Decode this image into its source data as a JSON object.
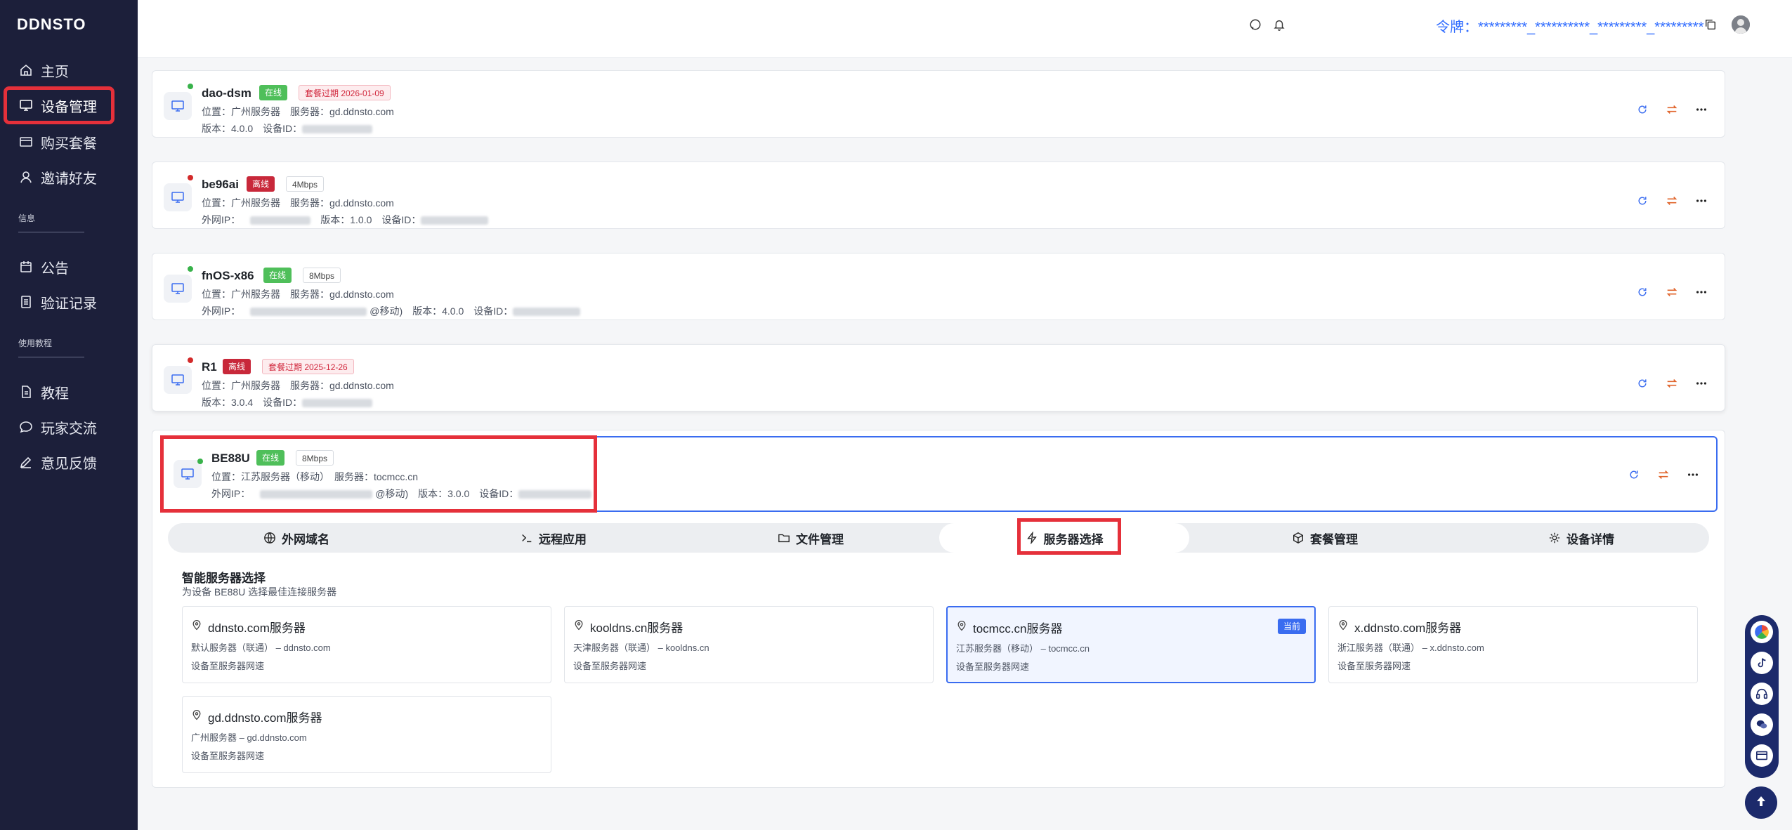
{
  "app": {
    "logo": "DDNSTO"
  },
  "sidebar": {
    "items": [
      {
        "label": "主页",
        "icon": "home-icon"
      },
      {
        "label": "设备管理",
        "icon": "monitor-icon"
      },
      {
        "label": "购买套餐",
        "icon": "card-icon"
      },
      {
        "label": "邀请好友",
        "icon": "user-icon"
      },
      {
        "label": "公告",
        "icon": "calendar-icon"
      },
      {
        "label": "验证记录",
        "icon": "list-icon"
      },
      {
        "label": "教程",
        "icon": "doc-icon"
      },
      {
        "label": "玩家交流",
        "icon": "chat-icon"
      },
      {
        "label": "意见反馈",
        "icon": "edit-icon"
      }
    ],
    "sections": {
      "info": "信息",
      "tutorial": "使用教程"
    }
  },
  "topbar": {
    "token_label": "令牌：",
    "token_value": "*********_**********_*********_*********"
  },
  "devices": [
    {
      "name": "dao-dsm",
      "status": "在线",
      "extra_badge": "套餐过期 2026-01-09",
      "line1": "位置：广州服务器　服务器：gd.ddnsto.com",
      "line2_prefix": "版本：4.0.0　设备ID："
    },
    {
      "name": "be96ai",
      "status": "离线",
      "extra_badge": "4Mbps",
      "line1": "位置：广州服务器　服务器：gd.ddnsto.com",
      "line2_prefix": "外网IP：",
      "line2_mid": "版本：1.0.0　设备ID："
    },
    {
      "name": "fnOS-x86",
      "status": "在线",
      "extra_badge": "8Mbps",
      "line1": "位置：广州服务器　服务器：gd.ddnsto.com",
      "line2_prefix": "外网IP：",
      "line2_mid": "@移动)　版本：4.0.0　设备ID："
    },
    {
      "name": "R1",
      "status": "离线",
      "extra_badge": "套餐过期 2025-12-26",
      "line1": "位置：广州服务器　服务器：gd.ddnsto.com",
      "line2_prefix": "版本：3.0.4　设备ID："
    },
    {
      "name": "BE88U",
      "status": "在线",
      "extra_badge": "8Mbps",
      "line1": "位置：江苏服务器（移动）　服务器：tocmcc.cn",
      "line2_prefix": "外网IP：",
      "line2_mid": "@移动)　版本：3.0.0　设备ID："
    }
  ],
  "tabs": [
    {
      "label": "外网域名",
      "icon": "globe-icon"
    },
    {
      "label": "远程应用",
      "icon": "terminal-icon"
    },
    {
      "label": "文件管理",
      "icon": "folder-icon"
    },
    {
      "label": "服务器选择",
      "icon": "lightning-icon"
    },
    {
      "label": "套餐管理",
      "icon": "box-icon"
    },
    {
      "label": "设备详情",
      "icon": "gear-icon"
    }
  ],
  "server_select": {
    "title": "智能服务器选择",
    "subtitle": "为设备 BE88U 选择最佳连接服务器",
    "current_label": "当前",
    "servers": [
      {
        "name": "ddnsto.com服务器",
        "desc": "默认服务器（联通） – ddnsto.com",
        "speed": "设备至服务器网速"
      },
      {
        "name": "kooldns.cn服务器",
        "desc": "天津服务器（联通） – kooldns.cn",
        "speed": "设备至服务器网速"
      },
      {
        "name": "tocmcc.cn服务器",
        "desc": "江苏服务器（移动） – tocmcc.cn",
        "speed": "设备至服务器网速"
      },
      {
        "name": "x.ddnsto.com服务器",
        "desc": "浙江服务器（联通） – x.ddnsto.com",
        "speed": "设备至服务器网速"
      },
      {
        "name": "gd.ddnsto.com服务器",
        "desc": "广州服务器 – gd.ddnsto.com",
        "speed": "设备至服务器网速"
      }
    ]
  },
  "colors": {
    "sidebar_bg": "#1c1f3a",
    "accent": "#3a6cf0",
    "online": "#4fbf5a",
    "offline": "#c8283a",
    "highlight": "#e5303a"
  }
}
